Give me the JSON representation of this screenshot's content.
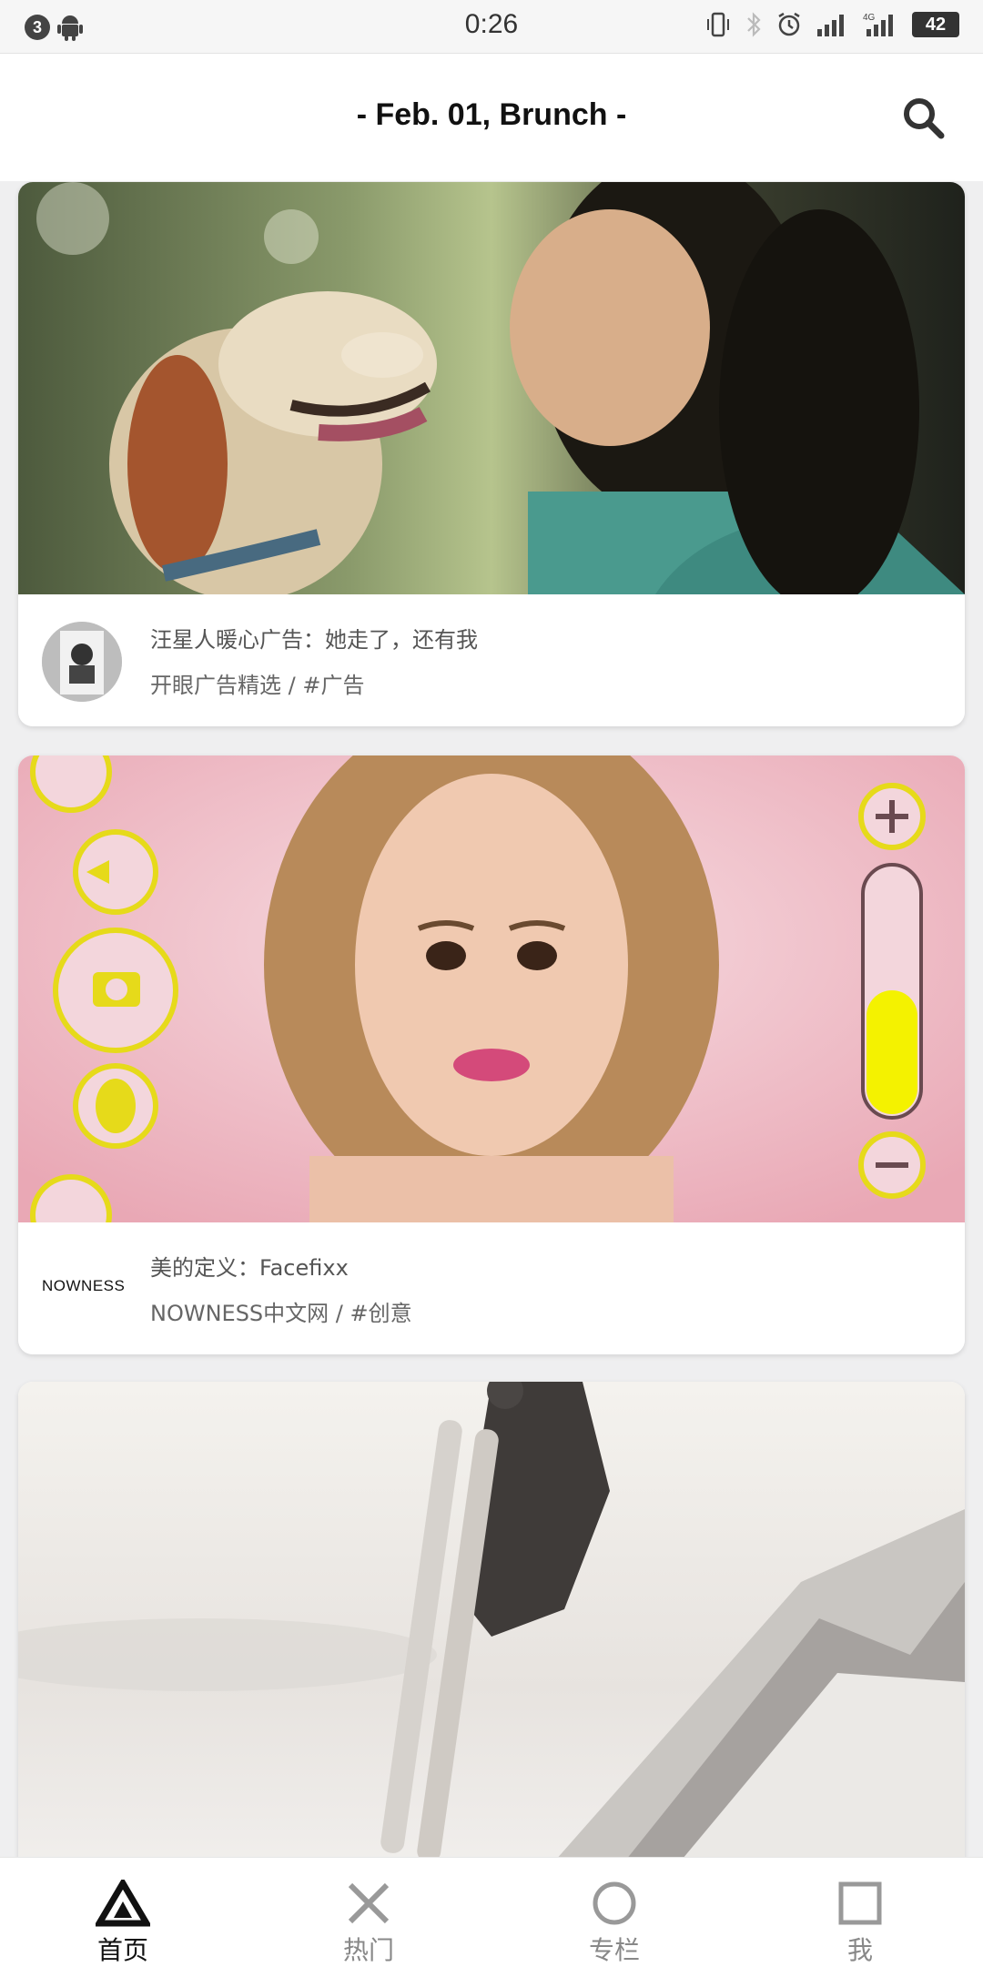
{
  "status_bar": {
    "notification_count": "3",
    "time": "0:26",
    "network": "4G",
    "battery": "42"
  },
  "header": {
    "title": "- Feb. 01, Brunch -"
  },
  "feed": [
    {
      "title": "汪星人暖心广告：她走了，还有我",
      "subtitle": "开眼广告精选 / #广告"
    },
    {
      "brand": "NOWNESS",
      "title": "美的定义：Facefixx",
      "subtitle": "NOWNESS中文网 / #创意"
    },
    {
      "title": "",
      "subtitle": ""
    }
  ],
  "bottom_nav": [
    {
      "label": "首页",
      "icon": "triangle-icon",
      "active": true
    },
    {
      "label": "热门",
      "icon": "cross-icon",
      "active": false
    },
    {
      "label": "专栏",
      "icon": "circle-icon",
      "active": false
    },
    {
      "label": "我",
      "icon": "square-icon",
      "active": false
    }
  ]
}
